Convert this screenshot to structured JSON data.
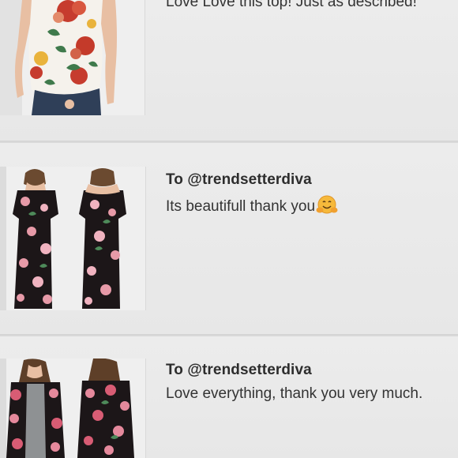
{
  "reviews": [
    {
      "recipient": "",
      "message": "Love Love this top! Just as described!",
      "emoji": ""
    },
    {
      "recipient": "To @trendsetterdiva",
      "message": "Its beautifull thank you",
      "emoji": "hugging-face-emoji"
    },
    {
      "recipient": "To @trendsetterdiva",
      "message": "Love everything, thank you very much.",
      "emoji": ""
    }
  ],
  "colors": {
    "background": "#e6e6e6",
    "divider": "#d2d2d2",
    "text": "#333333"
  }
}
